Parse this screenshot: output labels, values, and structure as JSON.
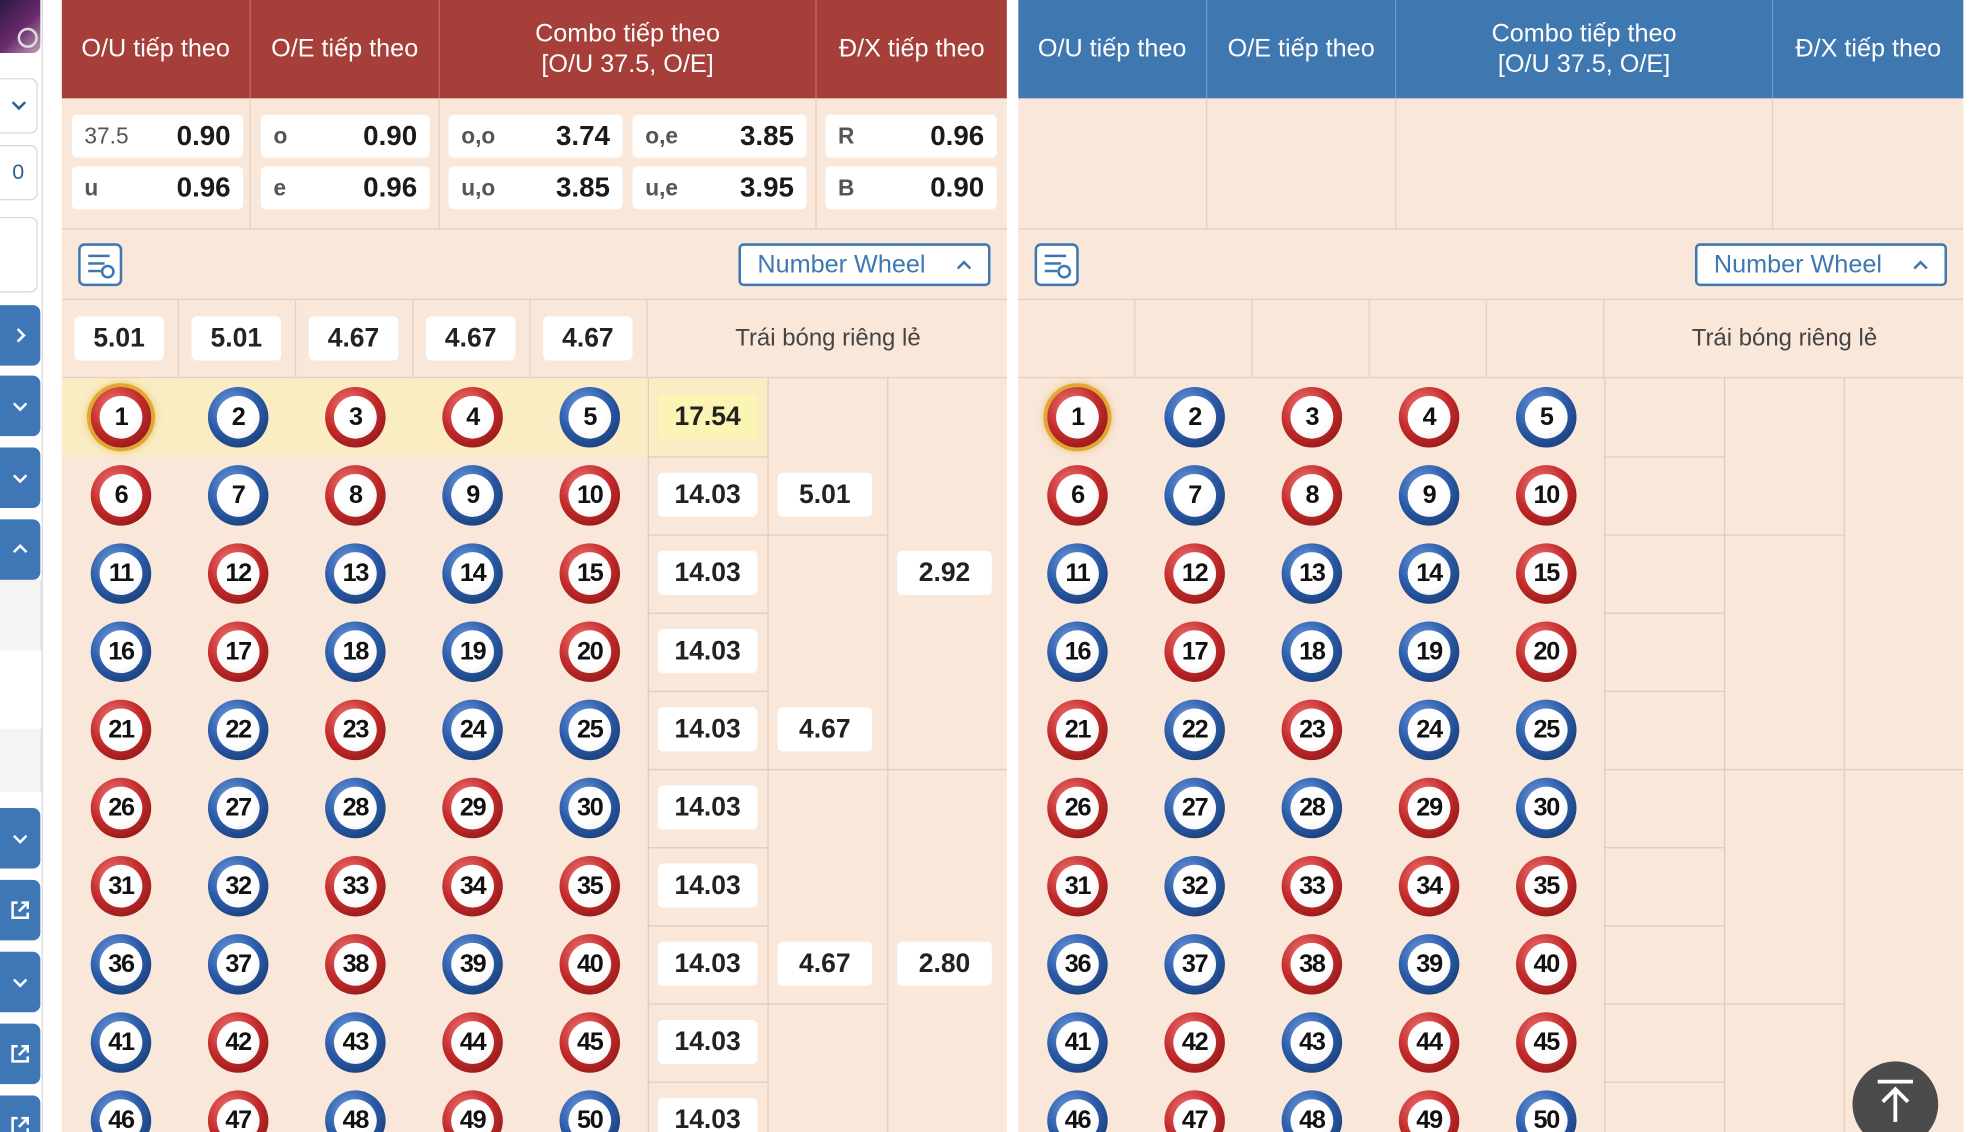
{
  "colors": {
    "left_header": "#a63e3a",
    "right_header": "#3f77b1",
    "panel_bg": "#f9e7da",
    "highlight_row": "#faecc3",
    "highlight_odds": "#fbf4b4"
  },
  "left_panel": {
    "headers": {
      "ou": "O/U tiếp theo",
      "oe": "O/E tiếp theo",
      "combo": "Combo tiếp theo\n[O/U 37.5, O/E]",
      "dx": "Đ/X tiếp theo"
    },
    "odds": {
      "ou_over_label": "37.5",
      "ou_over_value": "0.90",
      "ou_under_label": "u",
      "ou_under_value": "0.96",
      "oe_odd_label": "o",
      "oe_odd_value": "0.90",
      "oe_even_label": "e",
      "oe_even_value": "0.96",
      "combo_oo_label": "o,o",
      "combo_oo_value": "3.74",
      "combo_oe_label": "o,e",
      "combo_oe_value": "3.85",
      "combo_uo_label": "u,o",
      "combo_uo_value": "3.85",
      "combo_ue_label": "u,e",
      "combo_ue_value": "3.95",
      "dx_red_label": "R",
      "dx_red_value": "0.96",
      "dx_black_label": "B",
      "dx_black_value": "0.90"
    },
    "number_wheel_label": "Number Wheel",
    "column_odds": [
      "5.01",
      "5.01",
      "4.67",
      "4.67",
      "4.67"
    ],
    "single_ball_label": "Trái bóng riêng lẻ",
    "row_odds": [
      "17.54",
      "14.03",
      "14.03",
      "14.03",
      "14.03",
      "14.03",
      "14.03",
      "14.03",
      "14.03",
      "14.03"
    ],
    "group_odds": [
      "5.01",
      "4.67",
      "4.67"
    ],
    "half_odds": [
      "2.92",
      "2.80"
    ]
  },
  "right_panel": {
    "headers": {
      "ou": "O/U tiếp theo",
      "oe": "O/E tiếp theo",
      "combo": "Combo tiếp theo\n[O/U 37.5, O/E]",
      "dx": "Đ/X tiếp theo"
    },
    "number_wheel_label": "Number Wheel",
    "single_ball_label": "Trái bóng riêng lẻ"
  },
  "balls": [
    {
      "n": "1",
      "c": "red"
    },
    {
      "n": "2",
      "c": "blue"
    },
    {
      "n": "3",
      "c": "red"
    },
    {
      "n": "4",
      "c": "red"
    },
    {
      "n": "5",
      "c": "blue"
    },
    {
      "n": "6",
      "c": "red"
    },
    {
      "n": "7",
      "c": "blue"
    },
    {
      "n": "8",
      "c": "red"
    },
    {
      "n": "9",
      "c": "blue"
    },
    {
      "n": "10",
      "c": "red"
    },
    {
      "n": "11",
      "c": "blue"
    },
    {
      "n": "12",
      "c": "red"
    },
    {
      "n": "13",
      "c": "blue"
    },
    {
      "n": "14",
      "c": "blue"
    },
    {
      "n": "15",
      "c": "red"
    },
    {
      "n": "16",
      "c": "blue"
    },
    {
      "n": "17",
      "c": "red"
    },
    {
      "n": "18",
      "c": "blue"
    },
    {
      "n": "19",
      "c": "blue"
    },
    {
      "n": "20",
      "c": "red"
    },
    {
      "n": "21",
      "c": "red"
    },
    {
      "n": "22",
      "c": "blue"
    },
    {
      "n": "23",
      "c": "red"
    },
    {
      "n": "24",
      "c": "blue"
    },
    {
      "n": "25",
      "c": "blue"
    },
    {
      "n": "26",
      "c": "red"
    },
    {
      "n": "27",
      "c": "blue"
    },
    {
      "n": "28",
      "c": "blue"
    },
    {
      "n": "29",
      "c": "red"
    },
    {
      "n": "30",
      "c": "blue"
    },
    {
      "n": "31",
      "c": "red"
    },
    {
      "n": "32",
      "c": "blue"
    },
    {
      "n": "33",
      "c": "red"
    },
    {
      "n": "34",
      "c": "red"
    },
    {
      "n": "35",
      "c": "red"
    },
    {
      "n": "36",
      "c": "blue"
    },
    {
      "n": "37",
      "c": "blue"
    },
    {
      "n": "38",
      "c": "red"
    },
    {
      "n": "39",
      "c": "blue"
    },
    {
      "n": "40",
      "c": "red"
    },
    {
      "n": "41",
      "c": "blue"
    },
    {
      "n": "42",
      "c": "red"
    },
    {
      "n": "43",
      "c": "blue"
    },
    {
      "n": "44",
      "c": "red"
    },
    {
      "n": "45",
      "c": "red"
    },
    {
      "n": "46",
      "c": "blue"
    },
    {
      "n": "47",
      "c": "red"
    },
    {
      "n": "48",
      "c": "blue"
    },
    {
      "n": "49",
      "c": "red"
    },
    {
      "n": "50",
      "c": "blue"
    }
  ],
  "selected_ball": "1",
  "left_strip": {
    "count_value": "0"
  },
  "icons": {
    "dropdown": "chevron-down-icon",
    "expand": "chevron-right-icon",
    "collapse": "chevron-up-icon",
    "external": "external-link-icon",
    "settings": "bet-settings-icon",
    "scroll_top": "arrow-up-to-top-icon"
  }
}
